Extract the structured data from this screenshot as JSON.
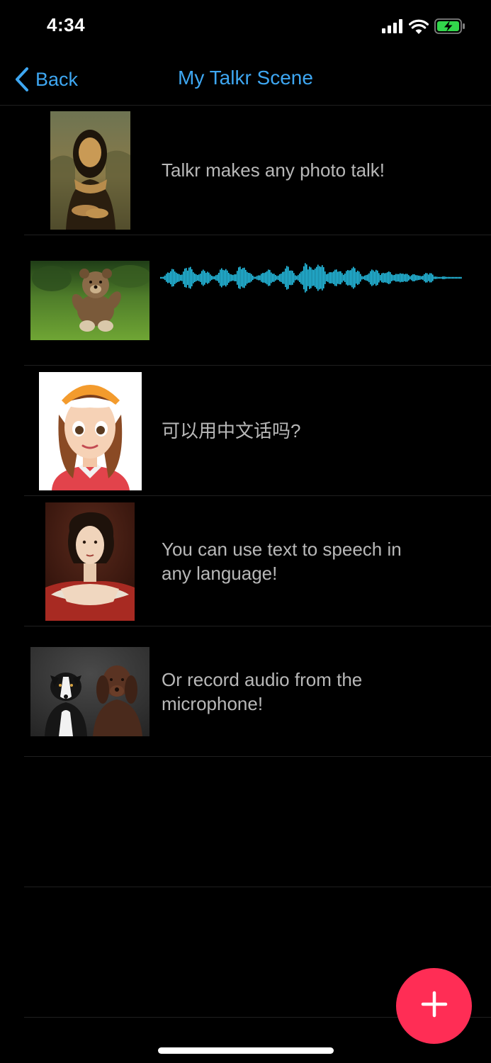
{
  "status_bar": {
    "time": "4:34",
    "signal_icon": "cellular-signal-icon",
    "wifi_icon": "wifi-icon",
    "battery_icon": "battery-charging-icon"
  },
  "nav": {
    "back_label": "Back",
    "title": "My Talkr Scene"
  },
  "rows": [
    {
      "thumb": "mona-lisa-portrait",
      "kind": "text",
      "text": "Talkr makes any photo talk!"
    },
    {
      "thumb": "teddy-bear-on-grass",
      "kind": "waveform",
      "text": ""
    },
    {
      "thumb": "cartoon-girl-cap",
      "kind": "text",
      "text": "可以用中文话吗?"
    },
    {
      "thumb": "baroque-woman-portrait",
      "kind": "text",
      "text": "You can use text to speech in any language!"
    },
    {
      "thumb": "two-dogs-photo",
      "kind": "text",
      "text": "Or record audio from the microphone!"
    }
  ],
  "fab": {
    "icon": "plus-icon"
  },
  "colors": {
    "accent": "#3ea7f2",
    "fab": "#ff2d55",
    "waveform": "#27c3e8",
    "row_text": "#b8b8b8",
    "background": "#000000"
  }
}
